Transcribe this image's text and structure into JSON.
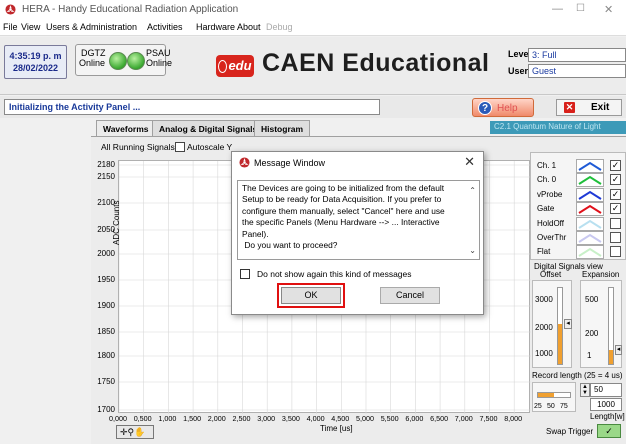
{
  "window": {
    "title": "HERA - Handy Educational Radiation Application",
    "controls": [
      "—",
      "☐",
      "✕"
    ]
  },
  "menu": [
    {
      "label": "File",
      "disabled": false
    },
    {
      "label": "View",
      "disabled": false
    },
    {
      "label": "Users & Administration",
      "disabled": false
    },
    {
      "label": "Activities",
      "disabled": false
    },
    {
      "label": "Hardware",
      "disabled": false
    },
    {
      "label": "About",
      "disabled": false
    },
    {
      "label": "Debug",
      "disabled": true
    }
  ],
  "header": {
    "time": "4:35:19 p. m",
    "date": "28/02/2022",
    "devices": [
      {
        "name": "DGTZ",
        "status": "Online"
      },
      {
        "name": "PSAU",
        "status": "Online"
      }
    ],
    "logo_mark": "edu",
    "brand": "CAEN Educational",
    "level_label": "Level",
    "level_value": "3: Full",
    "user_label": "User",
    "user_value": "Guest"
  },
  "status": {
    "message": "Initializing the Activity Panel ...",
    "help_label": "Help",
    "exit_label": "Exit",
    "activity": "C2.1 Quantum Nature of Light"
  },
  "tabs": [
    {
      "label": "Waveforms",
      "active": true
    },
    {
      "label": "Analog & Digital Signals",
      "active": false
    },
    {
      "label": "Histogram",
      "active": false
    }
  ],
  "plot": {
    "running_label": "All Running Signals",
    "autoscale_label": "Autoscale Y",
    "ylabel": "ADC Counts",
    "xlabel": "Time [us]",
    "yticks": [
      "2180",
      "2150",
      "2100",
      "2050",
      "2000",
      "1950",
      "1900",
      "1850",
      "1800",
      "1750",
      "1700"
    ],
    "xticks": [
      "0,000",
      "0,500",
      "1,000",
      "1,500",
      "2,000",
      "2,500",
      "3,000",
      "3,500",
      "4,000",
      "4,500",
      "5,000",
      "5,500",
      "6,000",
      "6,500",
      "7,000",
      "7,500",
      "8,000"
    ]
  },
  "signals": [
    {
      "label": "Ch. 1",
      "color": "#1f5bd6",
      "checked": true
    },
    {
      "label": "Ch. 0",
      "color": "#1fbf3a",
      "checked": true
    },
    {
      "label": "vProbe",
      "color": "#1f3ad6",
      "checked": true
    },
    {
      "label": "Gate",
      "color": "#e0101a",
      "checked": true
    },
    {
      "label": "HoldOff",
      "color": "#b8e0f0",
      "checked": false
    },
    {
      "label": "OverThr",
      "color": "#c8c8f0",
      "checked": false
    },
    {
      "label": "Flat",
      "color": "#c8f0c8",
      "checked": false
    }
  ],
  "digital_view": {
    "title": "Digital Signals view",
    "offset_label": "Offset",
    "expansion_label": "Expansion",
    "offset_ticks": [
      "3000",
      "2000",
      "1000"
    ],
    "expansion_ticks": [
      "500",
      "200",
      "1"
    ]
  },
  "record": {
    "label": "Record length (25 = 4 us)",
    "slider_ticks": [
      "25",
      "50",
      "75"
    ],
    "value": "50",
    "length_value": "1000",
    "length_label": "Length[w]"
  },
  "swap_trigger_label": "Swap Trigger",
  "dialog": {
    "title": "Message Window",
    "message_lines": [
      "The Devices are going to be initialized from the default",
      "Setup to be ready for Data Acquisition. If you prefer to",
      "configure them manually, select \"Cancel\" here and use",
      "the specific Panels (Menu Hardware --> ... Interactive",
      "Panel).",
      " Do you want to proceed?"
    ],
    "checkbox_label": "Do not show again this kind of messages",
    "ok_label": "OK",
    "cancel_label": "Cancel"
  },
  "colors": {
    "accent": "#1a3a9a",
    "brand_red": "#d8251d",
    "activity_bg": "#3d9ab8",
    "highlight": "#e01010"
  }
}
